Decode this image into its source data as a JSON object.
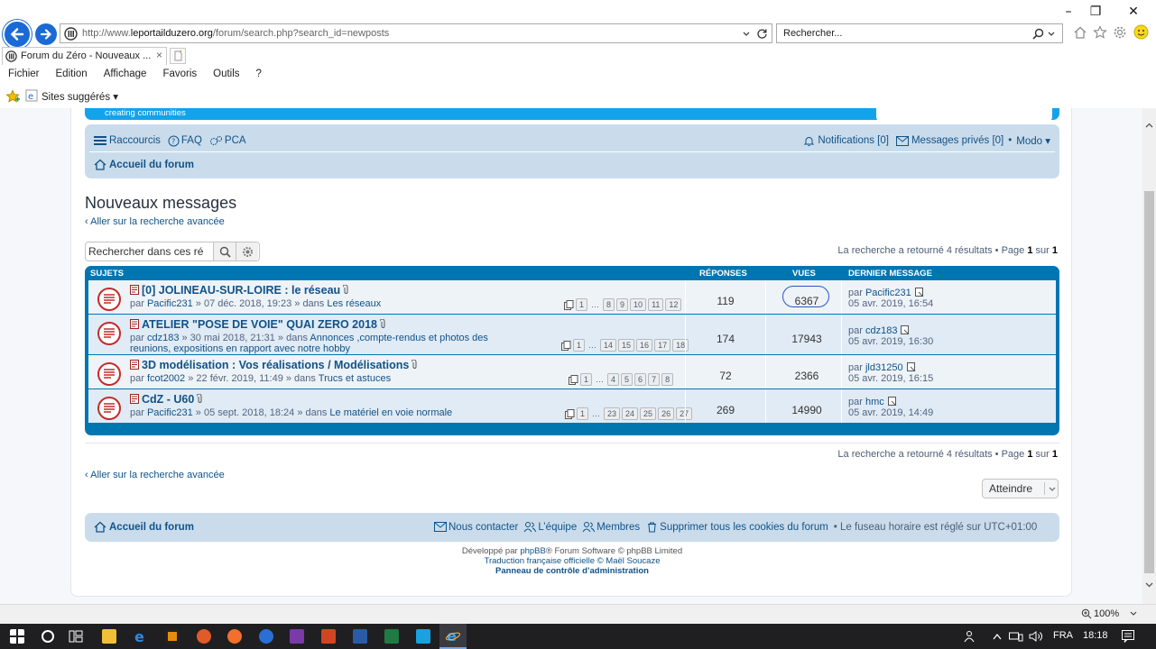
{
  "browser": {
    "url_prefix": "http://www.",
    "url_host": "leportailduzero.org",
    "url_path": "/forum/search.php?search_id=newposts",
    "search_placeholder": "Rechercher...",
    "tab_title": "Forum du Zéro - Nouveaux ...",
    "menu": [
      "Fichier",
      "Edition",
      "Affichage",
      "Favoris",
      "Outils",
      "?"
    ],
    "favorites_label": "Sites suggérés ▾",
    "zoom": "100%"
  },
  "site": {
    "tagline_a": "creating",
    "tagline_b": "communities"
  },
  "navbar": {
    "raccourcis": "Raccourcis",
    "faq": "FAQ",
    "pca": "PCA",
    "notifications": "Notifications [0]",
    "messages": "Messages privés [0]",
    "modo": "Modo ▾",
    "index": "Accueil du forum"
  },
  "page": {
    "title": "Nouveaux messages",
    "advanced_link": "‹ Aller sur la recherche avancée",
    "search_placeholder": "Rechercher dans ces ré",
    "results_prefix": "La recherche a retourné 4 résultats • Page ",
    "page_current": "1",
    "results_mid": " sur ",
    "page_total": "1",
    "jump_label": "Atteindre"
  },
  "table": {
    "head_subjects": "SUJETS",
    "head_replies": "RÉPONSES",
    "head_views": "VUES",
    "head_last": "DERNIER MESSAGE",
    "rows": [
      {
        "title": "[0] JOLINEAU-SUR-LOIRE : le réseau",
        "by_prefix": "par ",
        "author": "Pacific231",
        "date_mid": " » 07 déc. 2018, 19:23 » dans ",
        "forum": "Les réseaux",
        "forum_line2": "",
        "pages": [
          "1",
          "…",
          "8",
          "9",
          "10",
          "11",
          "12"
        ],
        "replies": "119",
        "views": "6367",
        "last_prefix": "par ",
        "last_author": "Pacific231",
        "last_date": "05 avr. 2019, 16:54"
      },
      {
        "title": "ATELIER \"POSE DE VOIE\" QUAI ZERO 2018",
        "by_prefix": "par ",
        "author": "cdz183",
        "date_mid": " » 30 mai 2018, 21:31 » dans ",
        "forum": "Annonces ,compte-rendus et photos des",
        "forum_line2": "reunions, expositions en rapport avec notre hobby",
        "pages": [
          "1",
          "…",
          "14",
          "15",
          "16",
          "17",
          "18"
        ],
        "replies": "174",
        "views": "17943",
        "last_prefix": "par ",
        "last_author": "cdz183",
        "last_date": "05 avr. 2019, 16:30"
      },
      {
        "title": "3D modélisation : Vos réalisations / Modélisations",
        "by_prefix": "par ",
        "author": "fcot2002",
        "date_mid": " » 22 févr. 2019, 11:49 » dans ",
        "forum": "Trucs et astuces",
        "forum_line2": "",
        "pages": [
          "1",
          "…",
          "4",
          "5",
          "6",
          "7",
          "8"
        ],
        "replies": "72",
        "views": "2366",
        "last_prefix": "par ",
        "last_author": "jld31250",
        "last_date": "05 avr. 2019, 16:15"
      },
      {
        "title": "CdZ - U60",
        "by_prefix": "par ",
        "author": "Pacific231",
        "date_mid": " » 05 sept. 2018, 18:24 » dans ",
        "forum": "Le matériel en voie normale",
        "forum_line2": "",
        "pages": [
          "1",
          "…",
          "23",
          "24",
          "25",
          "26",
          "27"
        ],
        "replies": "269",
        "views": "14990",
        "last_prefix": "par ",
        "last_author": "hmc",
        "last_date": "05 avr. 2019, 14:49"
      }
    ]
  },
  "footer": {
    "index": "Accueil du forum",
    "contact": "Nous contacter",
    "team": "L’équipe",
    "members": "Membres",
    "cookies": "Supprimer tous les cookies du forum",
    "timezone": "• Le fuseau horaire est réglé sur UTC+01:00",
    "credit_prefix": "Développé par ",
    "credit_phpbb": "phpBB",
    "credit_suffix": "® Forum Software © phpBB Limited",
    "translation_prefix": "Traduction française officielle © ",
    "translation_author": "Maël Soucaze",
    "admin_panel": "Panneau de contrôle d’administration"
  },
  "taskbar": {
    "lang": "FRA",
    "time": "18:18"
  }
}
